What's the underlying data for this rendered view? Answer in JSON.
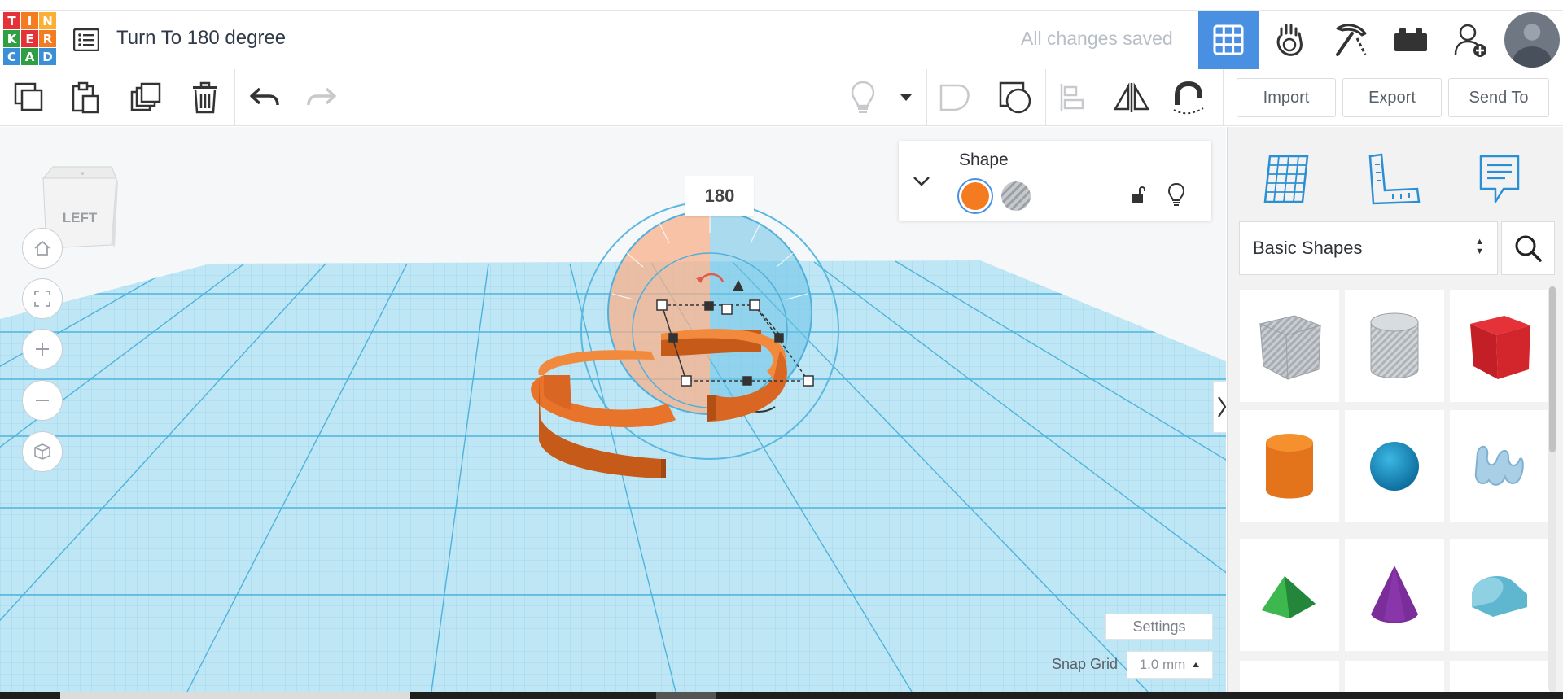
{
  "app": {
    "logo_letters": [
      "T",
      "I",
      "N",
      "K",
      "E",
      "R",
      "C",
      "A",
      "D"
    ],
    "logo_colors": [
      "#e53238",
      "#f47b20",
      "#fbb034",
      "#2ea043",
      "#e53238",
      "#f47b20",
      "#3a8fd7",
      "#2ea043",
      "#3a8fd7"
    ],
    "design_title": "Turn To 180 degree",
    "save_status": "All changes saved",
    "accent_color": "#4a90e2"
  },
  "header": {
    "icons": [
      "3d-design-grid-icon",
      "codeblocks-hand-icon",
      "minecraft-pickaxe-icon",
      "lego-brick-icon",
      "add-user-icon"
    ]
  },
  "toolbar": {
    "import_label": "Import",
    "export_label": "Export",
    "send_to_label": "Send To"
  },
  "viewport": {
    "viewcube_face": "LEFT",
    "rotation_value": "180",
    "shape_panel_title": "Shape",
    "solid_color": "#f47b20",
    "settings_label": "Settings",
    "snap_grid_label": "Snap Grid",
    "snap_grid_value": "1.0 mm"
  },
  "library": {
    "selected": "Basic Shapes",
    "shapes": [
      "box-hole",
      "cylinder-hole",
      "box",
      "cylinder",
      "sphere",
      "scribble",
      "roof",
      "cone",
      "round-roof"
    ]
  }
}
